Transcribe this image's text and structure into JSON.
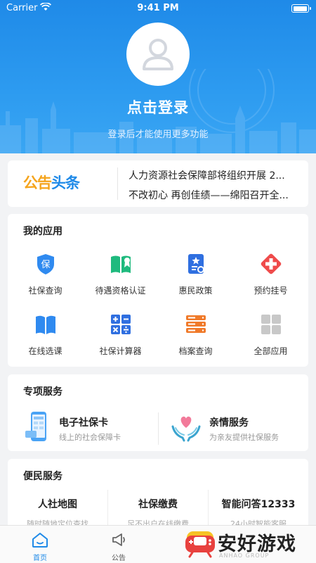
{
  "status_bar": {
    "carrier": "Carrier",
    "time": "9:41 PM",
    "battery_level": 1.0
  },
  "header": {
    "title": "点击登录",
    "subtitle": "登录后才能使用更多功能"
  },
  "notice": {
    "logo_part1": "公告",
    "logo_part2": "头条",
    "items": [
      "人力资源社会保障部将组织开展 2...",
      "不改初心 再创佳绩——绵阳召开全..."
    ]
  },
  "my_apps": {
    "title": "我的应用",
    "items": [
      {
        "label": "社保查询",
        "icon": "shield-icon",
        "color": "#2f8af0"
      },
      {
        "label": "待遇资格认证",
        "icon": "book-icon",
        "color": "#1fba7e"
      },
      {
        "label": "惠民政策",
        "icon": "policy-doc-icon",
        "color": "#2f6fe0"
      },
      {
        "label": "预约挂号",
        "icon": "medical-cross-icon",
        "color": "#ef4b4b"
      },
      {
        "label": "在线选课",
        "icon": "open-book-icon",
        "color": "#2f8af0"
      },
      {
        "label": "社保计算器",
        "icon": "calculator-icon",
        "color": "#2f6fe0"
      },
      {
        "label": "档案查询",
        "icon": "archive-icon",
        "color": "#f07a2a"
      },
      {
        "label": "全部应用",
        "icon": "grid-icon",
        "color": "#c8c8c8"
      }
    ]
  },
  "special_services": {
    "title": "专项服务",
    "items": [
      {
        "name": "电子社保卡",
        "desc": "线上的社会保障卡",
        "icon": "phone-card-icon"
      },
      {
        "name": "亲情服务",
        "desc": "为亲友提供社保服务",
        "icon": "heart-hands-icon"
      }
    ]
  },
  "convenience": {
    "title": "便民服务",
    "items": [
      {
        "name": "人社地图",
        "desc": "随时随地定位查找"
      },
      {
        "name": "社保缴费",
        "desc": "足不出户在线缴费"
      },
      {
        "name": "智能问答12333",
        "desc": "24小时智能客服"
      }
    ]
  },
  "tabbar": {
    "tabs": [
      {
        "label": "首页",
        "icon": "home-icon",
        "active": true
      },
      {
        "label": "公告",
        "icon": "megaphone-icon",
        "active": false
      }
    ],
    "active_color": "#1f8ae8"
  },
  "watermark": {
    "text": "安好游戏",
    "sub": "ANHAO GROUP"
  }
}
